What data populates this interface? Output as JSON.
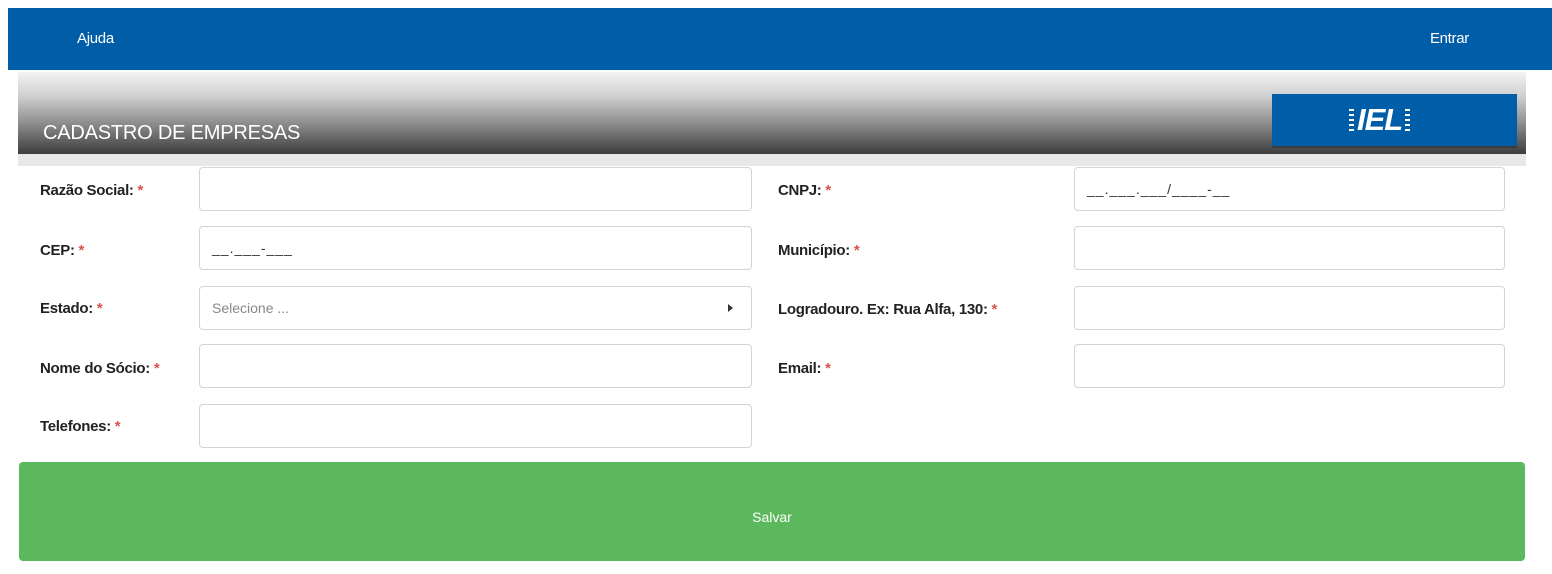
{
  "nav": {
    "help_label": "Ajuda",
    "login_label": "Entrar"
  },
  "header": {
    "title": "CADASTRO DE EMPRESAS",
    "logo_text": "IEL"
  },
  "form": {
    "razao_social": {
      "label": "Razão Social:",
      "required": "*",
      "value": ""
    },
    "cnpj": {
      "label": "CNPJ:",
      "required": "*",
      "value": "__.___.___/____-__"
    },
    "cep": {
      "label": "CEP:",
      "required": "*",
      "value": "__.___-___"
    },
    "municipio": {
      "label": "Município:",
      "required": "*",
      "value": ""
    },
    "estado": {
      "label": "Estado:",
      "required": "*",
      "placeholder": "Selecione ..."
    },
    "logradouro": {
      "label": "Logradouro. Ex: Rua Alfa, 130:",
      "required": "*",
      "value": ""
    },
    "nome_socio": {
      "label": "Nome do Sócio:",
      "required": "*",
      "value": ""
    },
    "email": {
      "label": "Email:",
      "required": "*",
      "value": ""
    },
    "telefones": {
      "label": "Telefones:",
      "required": "*",
      "value": ""
    }
  },
  "actions": {
    "save_label": "Salvar"
  },
  "colors": {
    "nav_bg": "#005da8",
    "save_bg": "#5cb85c",
    "required": "#d9534f"
  }
}
